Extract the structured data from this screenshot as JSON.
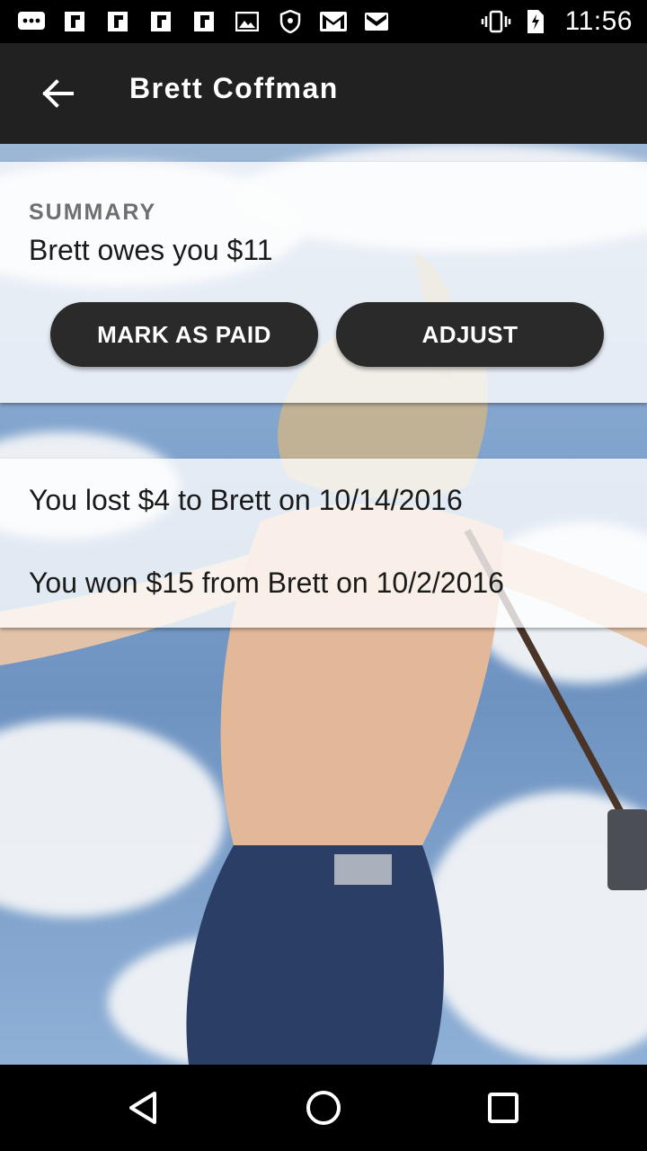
{
  "status_bar": {
    "time": "11:56",
    "left_icons": [
      "chat-icon",
      "flipboard-icon",
      "flipboard-icon",
      "flipboard-icon",
      "flipboard-icon",
      "image-icon",
      "shield-icon",
      "gmail-icon",
      "gmail-icon"
    ],
    "right_icons": [
      "vibrate-icon",
      "no-sim-icon",
      "battery-icon"
    ]
  },
  "toolbar": {
    "title": "Brett Coffman",
    "back_icon": "arrow-back-icon"
  },
  "summary": {
    "label": "SUMMARY",
    "text": "Brett owes you $11",
    "mark_paid_label": "MARK AS PAID",
    "adjust_label": "ADJUST"
  },
  "history": {
    "items": [
      {
        "text": "You lost $4 to Brett on 10/14/2016"
      },
      {
        "text": "You won $15 from Brett on 10/2/2016"
      }
    ]
  },
  "nav": {
    "back_icon": "triangle-back-icon",
    "home_icon": "circle-home-icon",
    "recents_icon": "square-recents-icon"
  },
  "colors": {
    "toolbar": "#212121",
    "button": "#2a2a2a",
    "card": "#ffffffc7"
  }
}
